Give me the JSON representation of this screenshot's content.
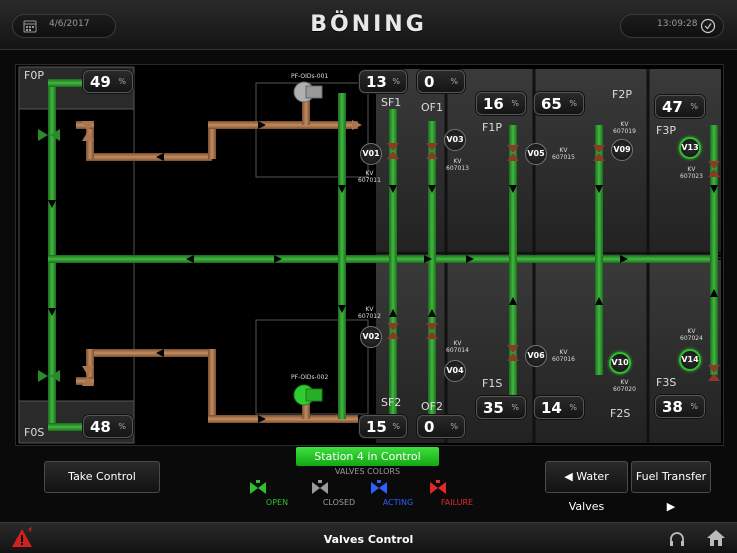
{
  "header": {
    "date": "4/6/2017",
    "brand": "BÖNING",
    "time": "13:09:28"
  },
  "tanks": {
    "f0p": "F0P",
    "f0s": "F0S",
    "f1p": "F1P",
    "f1s": "F1S",
    "f2p": "F2P",
    "f2s": "F2S",
    "f3p": "F3P",
    "f3s": "F3S",
    "sf1": "SF1",
    "sf2": "SF2",
    "of1": "OF1",
    "of2": "OF2"
  },
  "readouts": {
    "unit": "%",
    "f0p": "49",
    "f0s": "48",
    "sf1": "13",
    "of1": "0",
    "sf2": "15",
    "of2": "0",
    "f1p": "16",
    "f2p_left": "65",
    "f3p": "47",
    "f1s": "35",
    "f2s_left": "14",
    "f3s": "38"
  },
  "pumps": {
    "pump1": "PF-OIDs-001",
    "pump2": "PF-OIDs-002"
  },
  "valves": {
    "v01": "V01",
    "v02": "V02",
    "v03": "V03",
    "v04": "V04",
    "v05": "V05",
    "v06": "V06",
    "v09": "V09",
    "v10": "V10",
    "v13": "V13",
    "v14": "V14"
  },
  "kv_labels": {
    "kv_prefix": "KV",
    "v01": "607011",
    "v02": "607012",
    "v03": "607013",
    "v04": "607014",
    "v05": "607015",
    "v06": "607016",
    "v09": "607019",
    "v10": "607020",
    "v13": "607023",
    "v14": "607024"
  },
  "controls": {
    "take_control": "Take Control",
    "station_status": "Station 4 in Control",
    "water_valves": "◀ Water Valves",
    "fuel_transfer": "Fuel Transfer ▶"
  },
  "legend": {
    "title": "VALVES COLORS",
    "items": [
      {
        "label": "OPEN",
        "color": "#2fbf2f"
      },
      {
        "label": "CLOSED",
        "color": "#9a9a9a"
      },
      {
        "label": "ACTING",
        "color": "#2f5fff"
      },
      {
        "label": "FAILURE",
        "color": "#e02a2a"
      }
    ]
  },
  "footer": {
    "title": "Valves Control"
  },
  "colors": {
    "fuel_pipe": "#2c8a2c",
    "water_pipe": "#a97650",
    "accent_green": "#3ee03e",
    "alarm_red": "#d02020"
  }
}
